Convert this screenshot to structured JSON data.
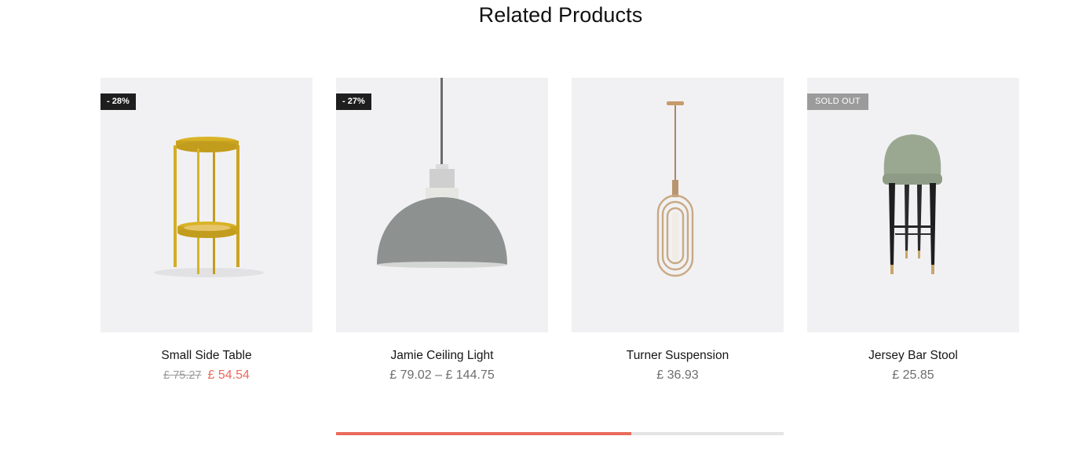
{
  "section": {
    "title": "Related Products"
  },
  "products": [
    {
      "name": "Small Side Table",
      "badge": "- 28%",
      "price_old": "£ 75.27",
      "price_sale": "£ 54.54",
      "image_icon": "side-table-image"
    },
    {
      "name": "Jamie Ceiling Light",
      "badge": "- 27%",
      "price_range": "£ 79.02 – £ 144.75",
      "image_icon": "ceiling-light-image"
    },
    {
      "name": "Turner Suspension",
      "price": "£ 36.93",
      "image_icon": "suspension-lamp-image"
    },
    {
      "name": "Jersey Bar Stool",
      "badge": "SOLD OUT",
      "price": "£ 25.85",
      "image_icon": "bar-stool-image"
    }
  ],
  "carousel": {
    "progress": 0.66
  },
  "colors": {
    "accent": "#e96b5c",
    "card_bg": "#f1f1f3",
    "badge_dark": "#1e1e1e",
    "badge_soldout": "#9b9b9b"
  }
}
